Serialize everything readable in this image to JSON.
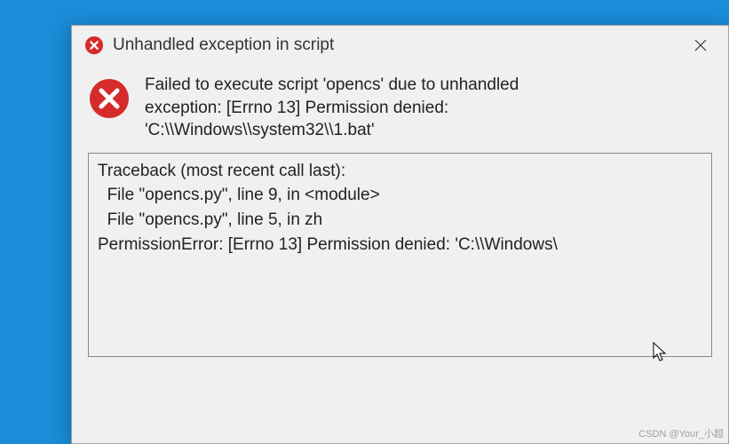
{
  "dialog": {
    "title": "Unhandled exception in script",
    "message_line1": "Failed to execute script 'opencs' due to unhandled",
    "message_line2": "exception: [Errno 13] Permission denied:",
    "message_line3": "'C:\\\\Windows\\\\system32\\\\1.bat'",
    "traceback": "Traceback (most recent call last):\n  File \"opencs.py\", line 9, in <module>\n  File \"opencs.py\", line 5, in zh\nPermissionError: [Errno 13] Permission denied: 'C:\\\\Windows\\"
  },
  "watermark": "CSDN @Your_小超"
}
